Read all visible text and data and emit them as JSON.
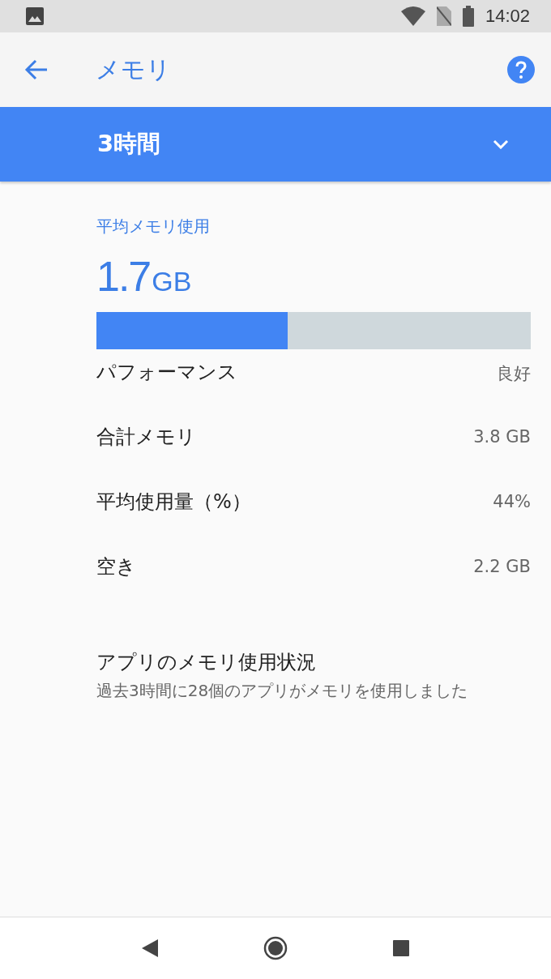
{
  "status_bar": {
    "time": "14:02"
  },
  "app_bar": {
    "title": "メモリ"
  },
  "period": {
    "label": "3時間"
  },
  "summary": {
    "label": "平均メモリ使用",
    "value": "1.7",
    "unit": "GB",
    "level": 0.44
  },
  "stats": [
    {
      "label": "パフォーマンス",
      "value": "良好"
    },
    {
      "label": "合計メモリ",
      "value": "3.8 GB"
    },
    {
      "label": "平均使用量（%）",
      "value": "44%"
    },
    {
      "label": "空き",
      "value": "2.2 GB"
    }
  ],
  "apps": {
    "title": "アプリのメモリ使用状況",
    "subtitle": "過去3時間に28個のアプリがメモリを使用しました"
  }
}
